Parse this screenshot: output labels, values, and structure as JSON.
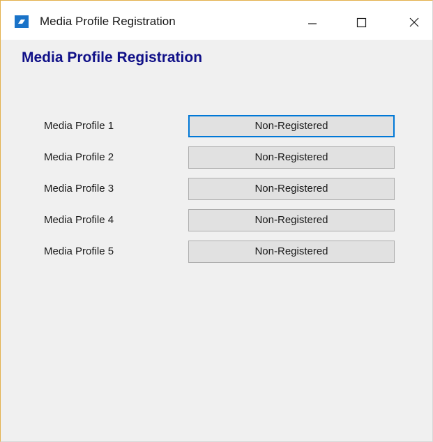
{
  "window": {
    "title": "Media Profile Registration",
    "icon": "app-icon",
    "controls": [
      "minimize-icon",
      "maximize-icon",
      "close-icon"
    ]
  },
  "heading": "Media Profile Registration",
  "profiles": [
    {
      "label": "Media Profile 1",
      "status": "Non-Registered",
      "focused": true
    },
    {
      "label": "Media Profile 2",
      "status": "Non-Registered",
      "focused": false
    },
    {
      "label": "Media Profile 3",
      "status": "Non-Registered",
      "focused": false
    },
    {
      "label": "Media Profile 4",
      "status": "Non-Registered",
      "focused": false
    },
    {
      "label": "Media Profile 5",
      "status": "Non-Registered",
      "focused": false
    }
  ],
  "colors": {
    "heading": "#101088",
    "focus_border": "#0078d7",
    "button_bg": "#e1e1e1",
    "client_bg": "#f0f0f0"
  }
}
